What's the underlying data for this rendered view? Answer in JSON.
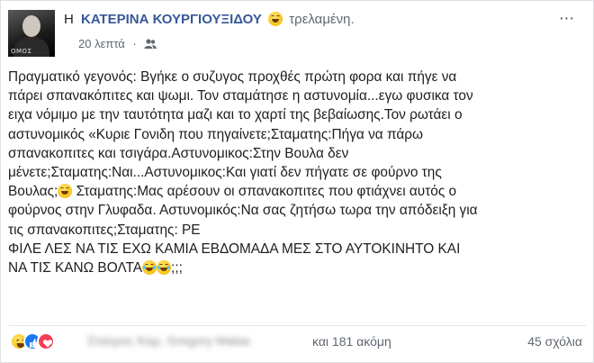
{
  "post": {
    "author_prefix": "Η",
    "author_name": "ΚΑΤΕΡΙΝΑ ΚΟΥΡΓΙΟΥΞΙΔΟΥ",
    "feeling": "τρελαμένη.",
    "timestamp": "20 λεπτά",
    "dot": "·",
    "more_label": "···",
    "avatar_tag": "ΟΜΟΣ",
    "lines": [
      "Πραγματικό γεγονός: Βγήκε ο συζυγος προχθές πρώτη φορα και πήγε να",
      "πάρει σπανακόπιτες και ψωμι. Τον σταμάτησε η αστυνομία...εγω φυσικα τον",
      "ειχα νόμιμο με την ταυτότητα μαζι και το χαρτί της βεβαίωσης.Τον ρωτάει ο",
      "αστυνομικός «Κυριε Γονιδη που πηγαίνετε;Σταματης:Πήγα να πάρω",
      "σπανακοπιτες και τσιγάρα.Αστυνομικος:Στην Βουλα δεν",
      "μένετε;Σταματης:Ναι...Αστυνομικος:Και γιατί δεν πήγατε σε φούρνο της",
      "Βουλας;",
      " Σταματης:Μας αρέσουν οι σπανακοπιτες που φτιάχνει αυτός ο",
      "φούρνος στην Γλυφαδα. Αστυνομικός:Να σας ζητήσω τωρα την απόδειξη για",
      "τις σπανακοπιτες;Σταματης: ΡΕ",
      "ΦΙΛΕ ΛΕΣ ΝΑ ΤΙΣ ΕΧΩ ΚΑΜΙΑ ΕΒΔΟΜΑΔΑ ΜΕΣ ΣΤΟ ΑΥΤΟΚΙΝΗΤΟ ΚΑΙ",
      "ΝΑ ΤΙΣ ΚΑΝΩ ΒΟΛΤΑ",
      ";;;"
    ]
  },
  "footer": {
    "blurred_names": "Σταύρος Καμ, Gregory Matas",
    "others": "και 181 ακόμη",
    "comments": "45 σχόλια"
  },
  "icons": {
    "reaction_haha": "haha-reaction-icon",
    "reaction_like": "like-reaction-icon",
    "reaction_love": "love-reaction-icon",
    "audience": "friends-audience-icon",
    "more": "more-options-icon"
  },
  "colors": {
    "author_link": "#385898",
    "meta_text": "#606770",
    "like_blue": "#1877f2",
    "love_red": "#f33e58"
  }
}
